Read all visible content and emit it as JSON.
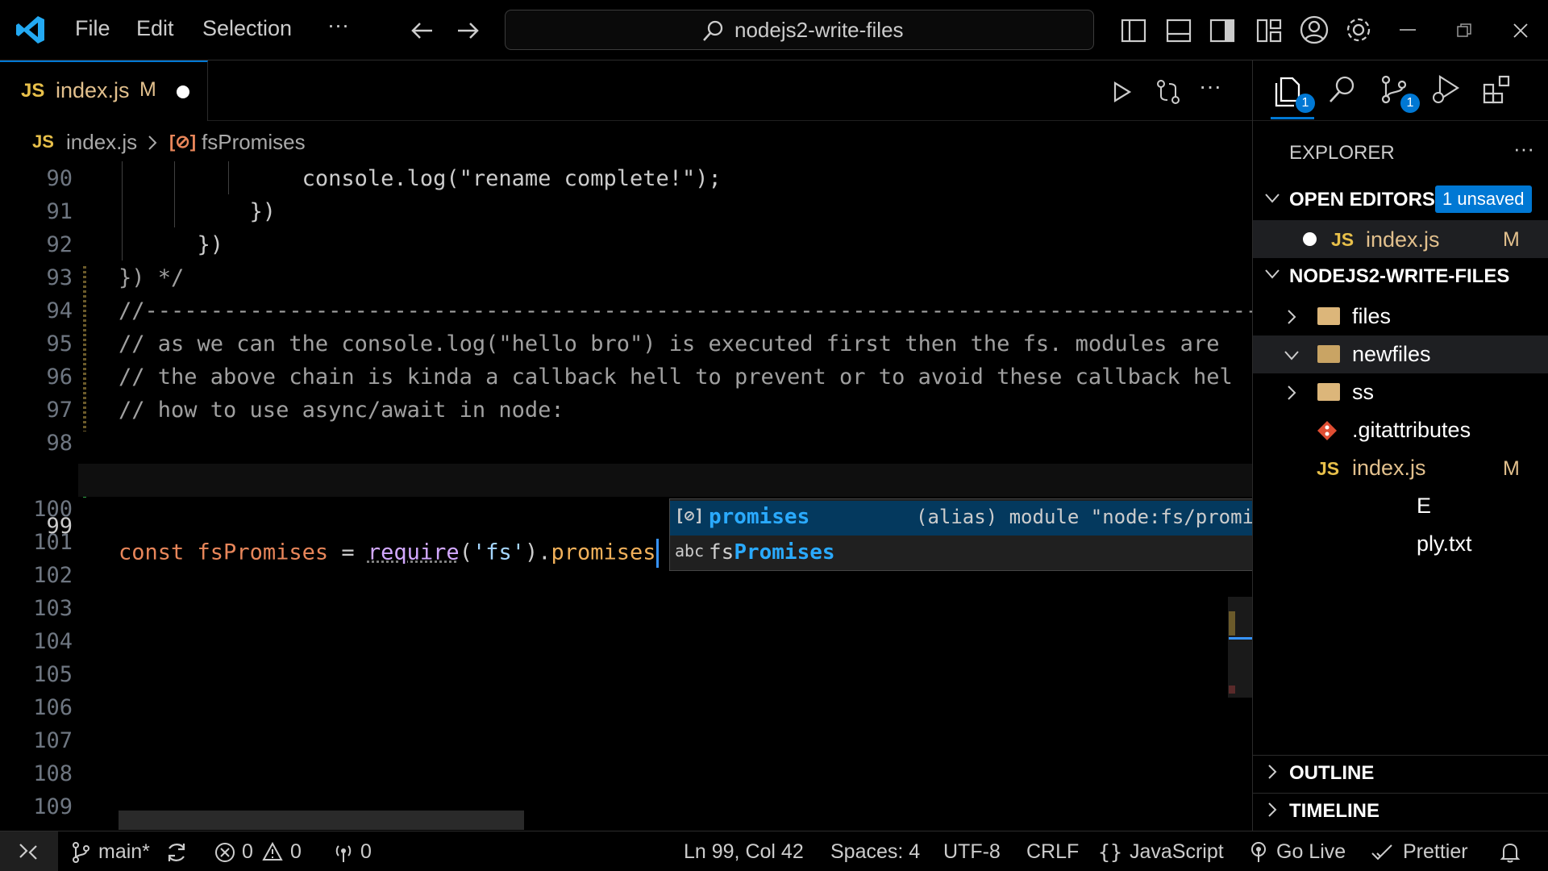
{
  "titlebar": {
    "menu": [
      "File",
      "Edit",
      "Selection"
    ],
    "more": "···",
    "search": "nodejs2-write-files"
  },
  "tab": {
    "badge": "JS",
    "label": "index.js",
    "status": "M"
  },
  "breadcrumb": {
    "file_badge": "JS",
    "file": "index.js",
    "symbol": "fsPromises"
  },
  "code": {
    "lines": [
      {
        "n": "90",
        "text": "              console.log(\"rename complete!\");"
      },
      {
        "n": "91",
        "text": "          })"
      },
      {
        "n": "92",
        "text": "      })"
      },
      {
        "n": "93",
        "text": "}) */"
      },
      {
        "n": "94",
        "text": "//-----------------------------------------------------------------------------------------"
      },
      {
        "n": "95",
        "text": "// as we can the console.log(\"hello bro\") is executed first then the fs. modules are"
      },
      {
        "n": "96",
        "text": "// the above chain is kinda a callback hell to prevent or to avoid these callback hel"
      },
      {
        "n": "97",
        "text": "// how to use async/await in node:"
      },
      {
        "n": "98",
        "text": ""
      },
      {
        "n": "99",
        "text": "const fsPromises = require('fs').promises"
      },
      {
        "n": "100",
        "text": ""
      },
      {
        "n": "101",
        "text": ""
      },
      {
        "n": "102",
        "text": ""
      },
      {
        "n": "103",
        "text": ""
      },
      {
        "n": "104",
        "text": ""
      },
      {
        "n": "105",
        "text": ""
      },
      {
        "n": "106",
        "text": ""
      },
      {
        "n": "107",
        "text": ""
      },
      {
        "n": "108",
        "text": ""
      },
      {
        "n": "109",
        "text": ""
      }
    ],
    "line99": {
      "kw": "const",
      "var": "fsPromises",
      "eq": " = ",
      "fn": "require",
      "p1": "(",
      "str": "'fs'",
      "p2": ").",
      "prop": "promises"
    }
  },
  "suggest": {
    "items": [
      {
        "icon": "[⊘]",
        "label_hl": "promises",
        "label_rest": "",
        "detail": "(alias) module \"node:fs/promises\"export p…"
      },
      {
        "icon": "abc",
        "label_pre": "fs",
        "label_hl": "Promises"
      }
    ]
  },
  "sidebar": {
    "title": "EXPLORER",
    "more": "···",
    "activity_badges": [
      "1",
      "1"
    ],
    "open_editors": {
      "label": "OPEN EDITORS",
      "badge": "1 unsaved"
    },
    "open_file": {
      "badge": "JS",
      "label": "index.js",
      "status": "M"
    },
    "project": "NODEJS2-WRITE-FILES",
    "tree": [
      {
        "label": "files"
      },
      {
        "label": "newfiles"
      },
      {
        "label": "ss"
      },
      {
        "label": ".gitattributes"
      },
      {
        "badge": "JS",
        "label": "index.js",
        "status": "M"
      },
      {
        "label": "E"
      },
      {
        "label": "ply.txt"
      }
    ],
    "outline": "OUTLINE",
    "timeline": "TIMELINE"
  },
  "statusbar": {
    "branch": "main*",
    "errors": "0",
    "warnings": "0",
    "ports": "0",
    "position": "Ln 99, Col 42",
    "spaces": "Spaces: 4",
    "encoding": "UTF-8",
    "eol": "CRLF",
    "language": "JavaScript",
    "golive": "Go Live",
    "prettier": "Prettier"
  },
  "colors": {
    "accent": "#0078d4",
    "modified": "#e2c08d",
    "js": "#e8c04a"
  }
}
